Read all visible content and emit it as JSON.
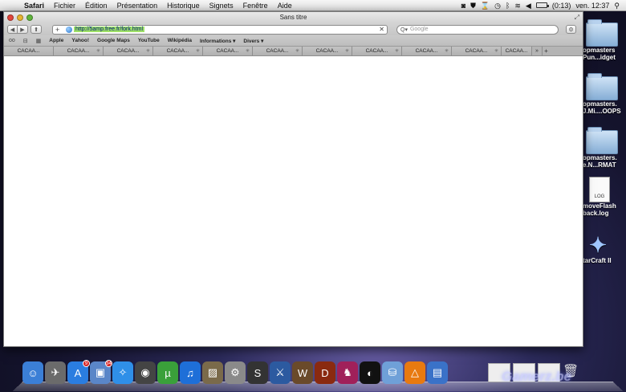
{
  "menubar": {
    "app_name": "Safari",
    "items": [
      "Fichier",
      "Édition",
      "Présentation",
      "Historique",
      "Signets",
      "Fenêtre",
      "Aide"
    ],
    "battery": "(0:13)",
    "clock": "ven. 12:37"
  },
  "desktop_icons": [
    {
      "label": "opmasters Pun...idget",
      "icon": "folder"
    },
    {
      "label": "opmasters. J.Mi....OOPS",
      "icon": "folder"
    },
    {
      "label": "opmasters. e.N...RMAT",
      "icon": "folder"
    },
    {
      "label": "moveFlash back.log",
      "icon": "log-file",
      "file_tag": "LOG"
    },
    {
      "label": "tarCraft II",
      "icon": "starcraft"
    }
  ],
  "window": {
    "title": "Sans titre",
    "url": "http://5amp.free.fr/fork.html",
    "search_placeholder": "Google"
  },
  "bookmarks": [
    "Apple",
    "Yahoo!",
    "Google Maps",
    "YouTube",
    "Wikipédia",
    "Informations ▾",
    "Divers ▾"
  ],
  "tabs": [
    "CACAA...",
    "CACAA...",
    "CACAA...",
    "CACAA...",
    "CACAA...",
    "CACAA...",
    "CACAA...",
    "CACAA...",
    "CACAA...",
    "CACAA...",
    "CACAA..."
  ],
  "dock": {
    "items": [
      {
        "name": "finder",
        "glyph": "☺",
        "color": "#3b7fd6"
      },
      {
        "name": "launchpad",
        "glyph": "✈",
        "color": "#6b6b6b"
      },
      {
        "name": "app-store",
        "glyph": "A",
        "color": "#2a7de0",
        "badge": "9"
      },
      {
        "name": "preview",
        "glyph": "▣",
        "color": "#5a86c8",
        "badge": "34"
      },
      {
        "name": "safari",
        "glyph": "✧",
        "color": "#2f8fe8"
      },
      {
        "name": "facetime",
        "glyph": "◉",
        "color": "#444"
      },
      {
        "name": "utorrent",
        "glyph": "µ",
        "color": "#3aa03a"
      },
      {
        "name": "itunes",
        "glyph": "♫",
        "color": "#1e6fd8"
      },
      {
        "name": "iphoto",
        "glyph": "▨",
        "color": "#7a6a4a"
      },
      {
        "name": "system-prefs",
        "glyph": "⚙",
        "color": "#8a8a8a"
      },
      {
        "name": "steam",
        "glyph": "S",
        "color": "#333"
      },
      {
        "name": "starcraft",
        "glyph": "⚔",
        "color": "#2c5aa0"
      },
      {
        "name": "warcraft",
        "glyph": "W",
        "color": "#6a4a2a"
      },
      {
        "name": "diablo",
        "glyph": "D",
        "color": "#8a2a10"
      },
      {
        "name": "game",
        "glyph": "♞",
        "color": "#a0205a"
      },
      {
        "name": "ableton-live",
        "glyph": "◐",
        "color": "#111"
      },
      {
        "name": "application",
        "glyph": "⛁",
        "color": "#6fa0d8"
      },
      {
        "name": "vlc",
        "glyph": "△",
        "color": "#e87a10"
      },
      {
        "name": "notes",
        "glyph": "▤",
        "color": "#3a72c8"
      }
    ]
  }
}
